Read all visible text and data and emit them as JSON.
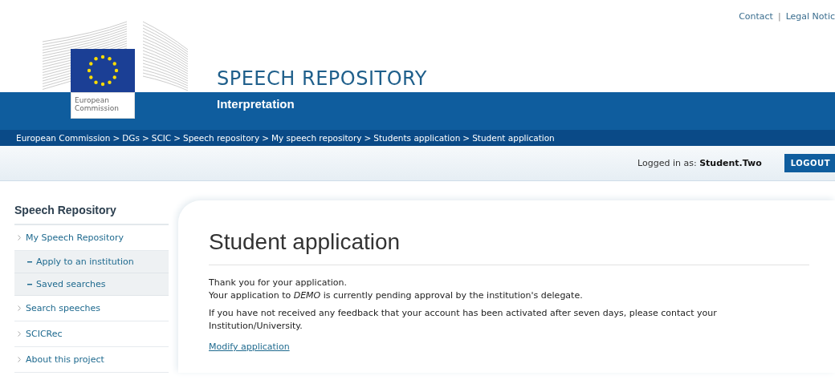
{
  "top_links": [
    "Contact",
    "Legal Notic"
  ],
  "top_links_separator": "|",
  "logo": {
    "caption": "European Commission"
  },
  "site": {
    "title": "SPEECH REPOSITORY",
    "subtitle": "Interpretation"
  },
  "breadcrumb": {
    "separator": ">",
    "items": [
      "European Commission",
      "DGs",
      "SCIC",
      "Speech repository",
      "My speech repository",
      "Students application",
      "Student application"
    ]
  },
  "user_bar": {
    "label": "Logged in as:",
    "user": "Student.Two",
    "logout": "LOGOUT"
  },
  "sidebar": {
    "title": "Speech Repository",
    "items": [
      {
        "label": "My Speech Repository",
        "children": [
          {
            "label": "Apply to an institution"
          },
          {
            "label": "Saved searches"
          }
        ]
      },
      {
        "label": "Search speeches"
      },
      {
        "label": "SCICRec"
      },
      {
        "label": "About this project"
      }
    ]
  },
  "main": {
    "title": "Student application",
    "paragraphs": [
      "Thank you for your application.\nYour application to *DEMO* is currently pending approval by the institution's delegate.",
      "If you have not received any feedback that your account has been activated after seven days, please contact your Institution/University."
    ],
    "link": "Modify application"
  }
}
